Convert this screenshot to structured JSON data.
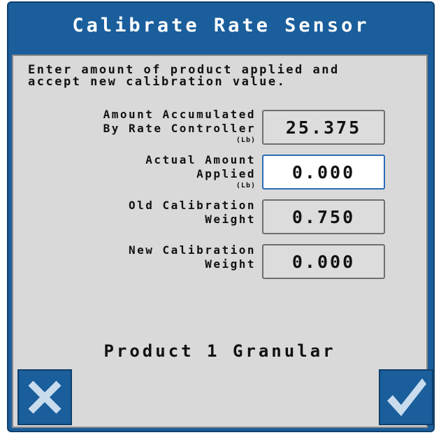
{
  "window": {
    "title": "Calibrate Rate Sensor"
  },
  "instruction": "Enter amount of product applied and\naccept new calibration value.",
  "fields": [
    {
      "label": "Amount Accumulated\nBy Rate Controller",
      "unit": "(Lb)",
      "value": "25.375",
      "editable": false
    },
    {
      "label": "Actual Amount\nApplied",
      "unit": "(Lb)",
      "value": "0.000",
      "editable": true
    },
    {
      "label": "Old Calibration\nWeight",
      "unit": "",
      "value": "0.750",
      "editable": false
    },
    {
      "label": "New Calibration\nWeight",
      "unit": "",
      "value": "0.000",
      "editable": false
    }
  ],
  "product": {
    "name": "Product 1 Granular"
  },
  "buttons": {
    "cancel_icon": "close-icon",
    "accept_icon": "checkmark-icon"
  },
  "colors": {
    "title_bar": "#1a5e9c",
    "panel": "#d9d9d9",
    "input_active": "#ffffff"
  }
}
